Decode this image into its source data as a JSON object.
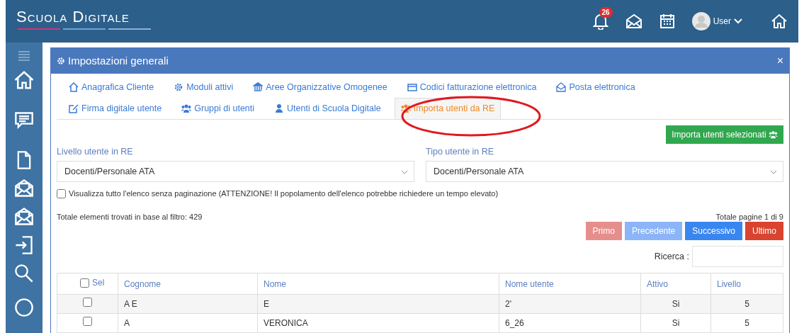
{
  "header": {
    "logo": "Scuola Digitale",
    "notifications": "26",
    "user": "User"
  },
  "sidebar": {
    "items": [
      {
        "kind": "menu"
      },
      {
        "kind": "home"
      },
      {
        "kind": "chat"
      },
      {
        "kind": "file"
      },
      {
        "kind": "mail"
      },
      {
        "kind": "mail"
      },
      {
        "kind": "login"
      },
      {
        "kind": "search"
      },
      {
        "kind": "partial"
      }
    ]
  },
  "dialog": {
    "title": "Impostazioni generali",
    "close": "×",
    "tabs": [
      {
        "label": "Anagrafica Cliente",
        "kind": "home",
        "selected": false
      },
      {
        "label": "Moduli attivi",
        "kind": "gear",
        "selected": false
      },
      {
        "label": "Aree Organizzative Omogenee",
        "kind": "bank",
        "selected": false
      },
      {
        "label": "Codici fatturazione elettronica",
        "kind": "card",
        "selected": false
      },
      {
        "label": "Posta elettronica",
        "kind": "mail",
        "selected": false
      },
      {
        "label": "Firma digitale utente",
        "kind": "edit",
        "selected": false
      },
      {
        "label": "Gruppi di utenti",
        "kind": "users",
        "selected": false
      },
      {
        "label": "Utenti di Scuola Digitale",
        "kind": "user",
        "selected": false
      },
      {
        "label": "Importa utenti da RE",
        "kind": "users",
        "selected": true
      }
    ],
    "import_button": "Importa utenti selezionati",
    "filters": [
      {
        "label": "Livello utente in RE",
        "value": "Docenti/Personale ATA"
      },
      {
        "label": "Tipo utente in RE",
        "value": "Docenti/Personale ATA"
      }
    ],
    "no_paging": {
      "label": "Visualizza tutto l'elenco senza paginazione (ATTENZIONE! Il popolamento dell'elenco potrebbe richiedere un tempo elevato)",
      "checked": false
    },
    "total": "Totale elementi trovati in base al filtro: 429",
    "pages": "Totale pagine 1 di 9",
    "pager": [
      {
        "label": "Primo",
        "kind": "first",
        "disabled": true
      },
      {
        "label": "Precedente",
        "kind": "prev",
        "disabled": true
      },
      {
        "label": "Successivo",
        "kind": "next",
        "disabled": false
      },
      {
        "label": "Ultimo",
        "kind": "last",
        "disabled": false
      }
    ],
    "search_label": "Ricerca :",
    "table": {
      "select_all": false,
      "select_label": "Sel",
      "columns": [
        "Cognome",
        "Nome",
        "Nome utente",
        "Attivo",
        "Livello"
      ],
      "rows": [
        {
          "checked": false,
          "cells": [
            "A  E",
            "E",
            "2'",
            "Si",
            "5"
          ]
        },
        {
          "checked": false,
          "cells": [
            "A",
            "VERONICA",
            "6_26",
            "Si",
            "5"
          ]
        }
      ]
    }
  }
}
